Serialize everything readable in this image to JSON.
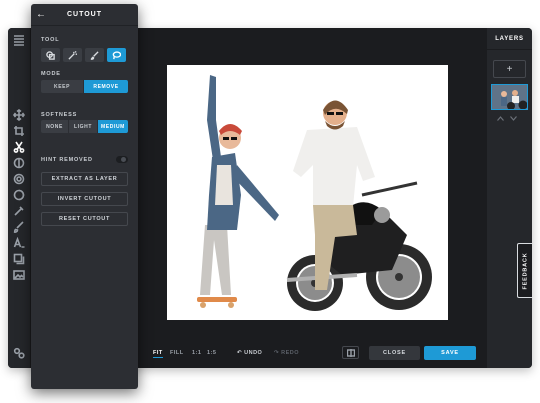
{
  "panel": {
    "title": "CUTOUT",
    "tool_label": "TOOL",
    "mode_label": "MODE",
    "mode_options": [
      "KEEP",
      "REMOVE"
    ],
    "mode_selected": "REMOVE",
    "softness_label": "SOFTNESS",
    "softness_options": [
      "NONE",
      "LIGHT",
      "MEDIUM"
    ],
    "softness_selected": "MEDIUM",
    "hint_label": "HINT REMOVED",
    "extract_label": "EXTRACT AS LAYER",
    "invert_label": "INVERT CUTOUT",
    "reset_label": "RESET CUTOUT"
  },
  "bottom_bar": {
    "zoom_options": [
      "FIT",
      "FILL",
      "1:1",
      "1:5"
    ],
    "zoom_selected": "FIT",
    "undo_label": "UNDO",
    "redo_label": "REDO",
    "close_label": "CLOSE",
    "save_label": "SAVE"
  },
  "layers": {
    "title": "LAYERS",
    "add_label": "+"
  },
  "feedback_label": "FEEDBACK",
  "colors": {
    "accent": "#1e9ad6",
    "background": "#1b1c1f",
    "panel": "#2c2e33"
  }
}
